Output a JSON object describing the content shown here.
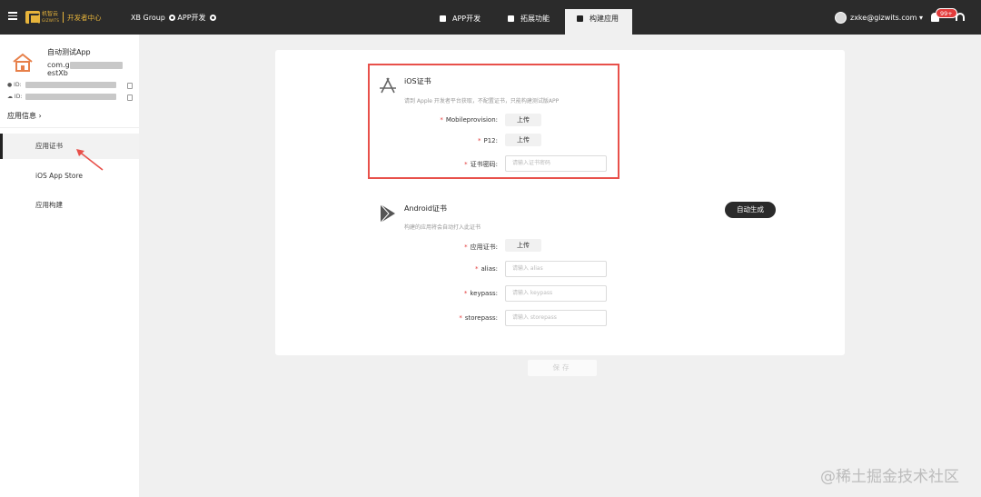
{
  "topbar": {
    "logo_text": "机智云",
    "logo_sub": "GIZWITS",
    "dev_center": "开发者中心",
    "group": "XB Group",
    "product": "APP开发",
    "tabs": [
      {
        "label": "APP开发",
        "active": false
      },
      {
        "label": "拓展功能",
        "active": false
      },
      {
        "label": "构建应用",
        "active": true
      }
    ],
    "user_email": "zxke@gizwits.com ▾",
    "notification_count": "99+"
  },
  "sidebar": {
    "app_name": "自动测试App",
    "bundle_prefix": "com.g",
    "bundle_suffix": "estXb",
    "ios_id_label": "ID:",
    "android_id_label": "ID:",
    "app_info_label": "应用信息 ›",
    "items": [
      {
        "label": "应用证书",
        "active": true
      },
      {
        "label": "iOS App Store",
        "active": false
      },
      {
        "label": "应用构建",
        "active": false
      }
    ]
  },
  "ios": {
    "title": "iOS证书",
    "desc": "请到 Apple 开发者平台获取，不配置证书，只能构建测试版APP",
    "fields": [
      {
        "label": "Mobileprovision:",
        "type": "upload",
        "button": "上传"
      },
      {
        "label": "P12:",
        "type": "upload",
        "button": "上传"
      },
      {
        "label": "证书密码:",
        "type": "input",
        "placeholder": "请输入证书密码"
      }
    ]
  },
  "android": {
    "title": "Android证书",
    "desc": "构建的应用将会自动打入此证书",
    "auto_button": "自动生成",
    "fields": [
      {
        "label": "应用证书:",
        "type": "upload",
        "button": "上传"
      },
      {
        "label": "alias:",
        "type": "input",
        "placeholder": "请输入 alias"
      },
      {
        "label": "keypass:",
        "type": "input",
        "placeholder": "请输入 keypass"
      },
      {
        "label": "storepass:",
        "type": "input",
        "placeholder": "请输入 storepass"
      }
    ]
  },
  "save_label": "保存",
  "watermark": "@稀土掘金技术社区",
  "colors": {
    "topbar": "#2b2b2b",
    "brand": "#e7b43b",
    "highlight": "#e8504a",
    "required": "#e23b3b"
  }
}
